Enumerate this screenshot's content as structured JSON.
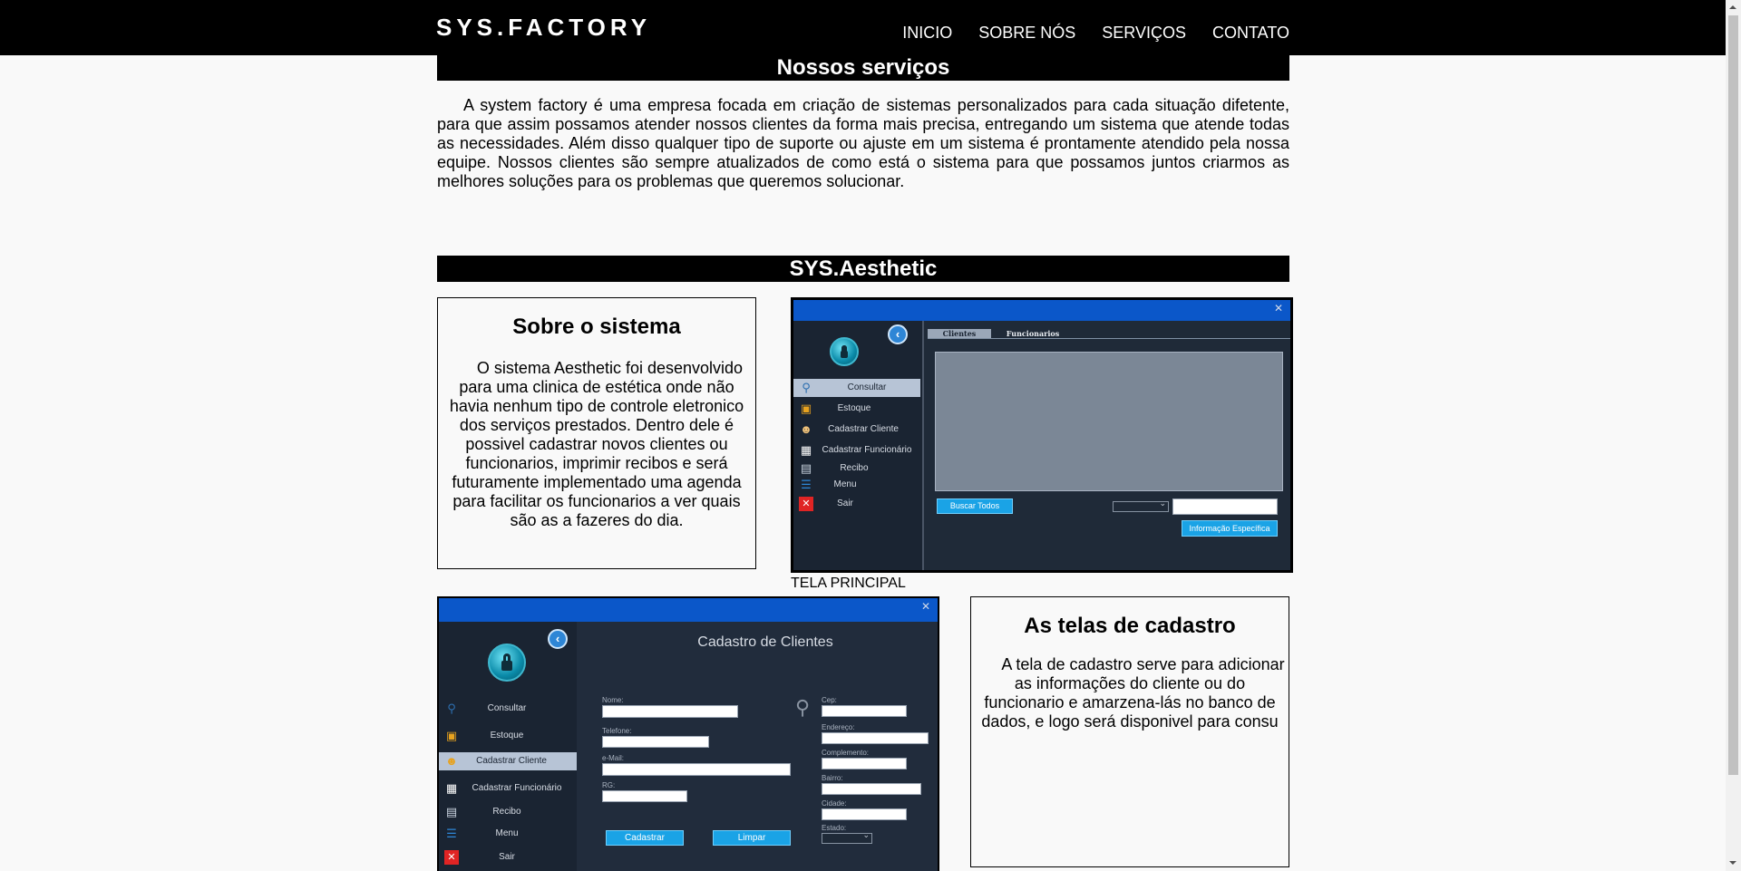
{
  "header": {
    "logo": "SYS.FACTORY",
    "nav": [
      "INICIO",
      "SOBRE NÓS",
      "SERVIÇOS",
      "CONTATO"
    ]
  },
  "services": {
    "title": "Nossos serviços",
    "intro": "A system factory é uma empresa focada em criação de sistemas personalizados para cada situação difetente, para que assim possamos atender nossos clientes da forma mais precisa, entregando um sistema que atende todas as necessidades. Além disso qualquer tipo de suporte ou ajuste em um sistema é prontamente atendido pela nossa equipe. Nossos clientes são sempre atualizados de como está o sistema para que possamos juntos criarmos as melhores soluções para os problemas que queremos solucionar."
  },
  "aesthetic": {
    "title": "SYS.Aesthetic",
    "about": {
      "heading": "Sobre o sistema",
      "text": "O sistema Aesthetic foi desenvolvido para uma clinica de estética onde não havia nenhum tipo de controle eletronico dos serviços prestados. Dentro dele é possivel cadastrar novos clientes ou funcionarios, imprimir recibos e será futuramente implementado uma agenda para facilitar os funcionarios a ver quais são as a fazeres do dia."
    },
    "caption_principal": "TELA PRINCIPAL",
    "cadastro": {
      "heading": "As telas de cadastro",
      "text": "A tela de cadastro serve para adicionar as informações do cliente ou do funcionario e amarzena-lás no banco de dados, e logo será disponivel para consu"
    }
  },
  "screenshot_principal": {
    "close": "✕",
    "menu": [
      "Consultar",
      "Estoque",
      "Cadastrar Cliente",
      "Cadastrar Funcionário",
      "Recibo",
      "Menu",
      "Sair"
    ],
    "tabs": [
      "Clientes",
      "Funcionarios"
    ],
    "buscar_todos": "Buscar Todos",
    "informacao_especifica": "Informação Específica"
  },
  "screenshot_cadastro": {
    "close": "✕",
    "title": "Cadastro de Clientes",
    "menu": [
      "Consultar",
      "Estoque",
      "Cadastrar Cliente",
      "Cadastrar Funcionário",
      "Recibo",
      "Menu",
      "Sair"
    ],
    "left_fields": [
      "Nome:",
      "Telefone:",
      "e-Mail:",
      "RG:"
    ],
    "right_fields": [
      "Cep:",
      "Endereço:",
      "Complemento:",
      "Bairro:",
      "Cidade:",
      "Estado:"
    ],
    "btn_cadastrar": "Cadastrar",
    "btn_limpar": "Limpar"
  },
  "icons": {
    "consultar": "magnifier-icon",
    "estoque": "cart-icon",
    "cadastrar_cliente": "add-user-icon",
    "cadastrar_funcionario": "badge-icon",
    "recibo": "printer-icon",
    "menu": "menu-icon",
    "sair": "close-icon"
  },
  "colors": {
    "header_bg": "#000000",
    "page_bg": "#f9f9f9",
    "app_titlebar": "#0b57c9",
    "app_sidebar": "#1a2432",
    "app_button": "#1aa3e6"
  }
}
